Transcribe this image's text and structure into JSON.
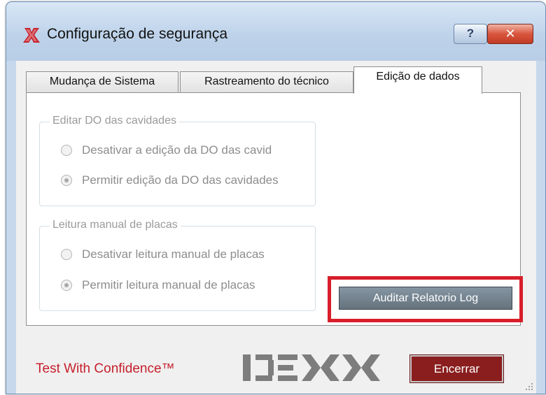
{
  "window": {
    "title": "Configuração de segurança",
    "help_label": "?",
    "close_label": "✕"
  },
  "tabs": [
    {
      "label": "Mudança de Sistema",
      "active": false
    },
    {
      "label": "Rastreamento do técnico",
      "active": false
    },
    {
      "label": "Edição de dados",
      "active": true
    }
  ],
  "groups": {
    "cavities": {
      "title": "Editar DO das cavidades",
      "options": [
        {
          "label": "Desativar a edição da DO das cavid",
          "selected": false
        },
        {
          "label": "Permitir edição da DO das cavidades",
          "selected": true
        }
      ]
    },
    "manual_reading": {
      "title": "Leitura manual de placas",
      "options": [
        {
          "label": "Desativar leitura manual de placas",
          "selected": false
        },
        {
          "label": "Permitir leitura manual de placas",
          "selected": true
        }
      ]
    }
  },
  "audit_button_label": "Auditar Relatorio Log",
  "footer": {
    "tagline": "Test With Confidence™",
    "logo_text": "IDEXX",
    "close_button_label": "Encerrar"
  },
  "colors": {
    "highlight": "#d81e2a",
    "brand_red": "#c6202c",
    "logo_gray": "#7d7d7d",
    "close_button": "#8a1e1e"
  },
  "icons": {
    "app": "app-x-icon",
    "help": "help-icon",
    "close": "close-icon",
    "grip": "resize-grip-icon"
  }
}
